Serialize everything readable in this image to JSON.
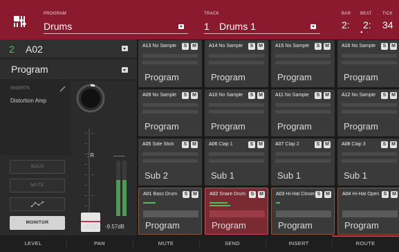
{
  "header": {
    "program_label": "PROGRAM",
    "program_value": "Drums",
    "track_label": "TRACK",
    "track_number": "1",
    "track_name": "Drums 1",
    "bar_label": "BAR",
    "bar_value": "2:",
    "beat_label": "BEAT",
    "beat_value": "2:",
    "tick_label": "TICK",
    "tick_value": "34",
    "accent_color": "#8b1a2e"
  },
  "left": {
    "pad_number": "2",
    "pad_name": "A02",
    "program_selector": "Program",
    "inserts_title": "INSERTS",
    "insert_item": "Distortion Amp",
    "knob_value": "1R",
    "solo_label": "SOLO",
    "mute_label": "MUTE",
    "monitor_label": "MONITOR",
    "level_label": "LEVEL",
    "level_value": "-9.57dB"
  },
  "pads": [
    {
      "id": "A13",
      "name": "No Sample",
      "label": "Program"
    },
    {
      "id": "A14",
      "name": "No Sample",
      "label": "Program"
    },
    {
      "id": "A15",
      "name": "No Sample",
      "label": "Program"
    },
    {
      "id": "A16",
      "name": "No Sample",
      "label": "Program"
    },
    {
      "id": "A09",
      "name": "No Sample",
      "label": "Program"
    },
    {
      "id": "A10",
      "name": "No Sample",
      "label": "Program"
    },
    {
      "id": "A11",
      "name": "No Sample",
      "label": "Program"
    },
    {
      "id": "A12",
      "name": "No Sample",
      "label": "Program"
    },
    {
      "id": "A05",
      "name": "Side Stick",
      "label": "Sub 2"
    },
    {
      "id": "A06",
      "name": "Clap 1",
      "label": "Sub 1"
    },
    {
      "id": "A07",
      "name": "Clap 2",
      "label": "Sub 1"
    },
    {
      "id": "A08",
      "name": "Clap 3",
      "label": "Sub 1"
    },
    {
      "id": "A01",
      "name": "Bass Drum",
      "label": "Program"
    },
    {
      "id": "A02",
      "name": "Snare Drum",
      "label": "Program"
    },
    {
      "id": "A03",
      "name": "Hi-Hat Closed",
      "label": "Program"
    },
    {
      "id": "A04",
      "name": "Hi-Hat Open",
      "label": "Program"
    }
  ],
  "pad_buttons": {
    "solo": "S",
    "mute": "M"
  },
  "footer": {
    "tabs": [
      "LEVEL",
      "PAN",
      "MUTE",
      "SEND",
      "INSERT",
      "ROUTE"
    ]
  }
}
